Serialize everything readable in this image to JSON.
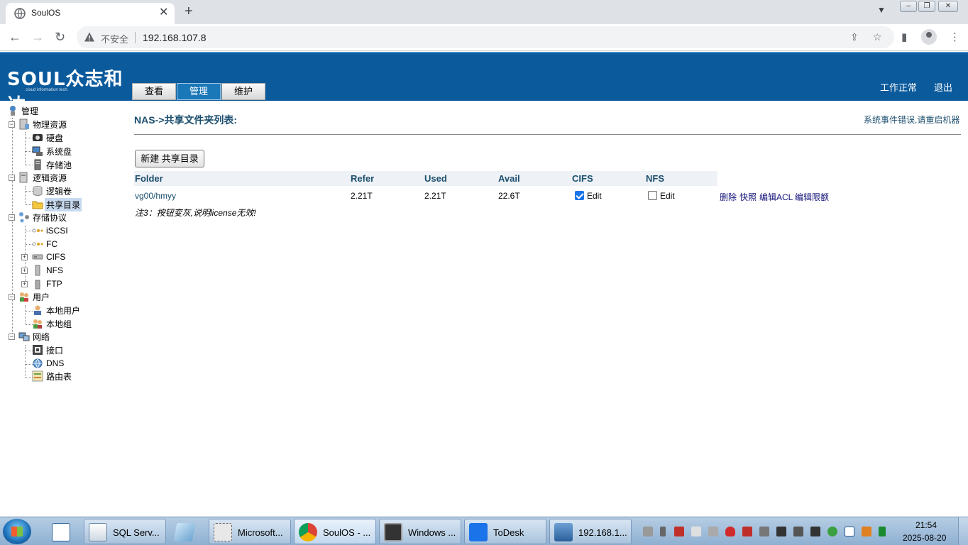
{
  "browser": {
    "tab_title": "SoulOS",
    "new_tab_symbol": "+",
    "close_symbol": "✕",
    "not_secure": "不安全",
    "url": "192.168.107.8"
  },
  "header": {
    "logo_text": "SOUL众志和达",
    "logo_subtitle": "cloud information tech.",
    "tabs": [
      {
        "label": "查看",
        "active": false
      },
      {
        "label": "管理",
        "active": true
      },
      {
        "label": "维护",
        "active": false
      }
    ],
    "status": "工作正常",
    "logout": "退出",
    "colors": {
      "header_bg": "#0b5a9c",
      "active_tab": "#1b78b8"
    }
  },
  "tree": {
    "root": "管理",
    "physical": "物理资源",
    "disk": "硬盘",
    "system_disk": "系统盘",
    "storage_pool": "存储池",
    "logical": "逻辑资源",
    "logical_volume": "逻辑卷",
    "shared_dir": "共享目录",
    "protocols": "存储协议",
    "iscsi": "iSCSI",
    "fc": "FC",
    "cifs": "CIFS",
    "nfs": "NFS",
    "ftp": "FTP",
    "users": "用户",
    "local_user": "本地用户",
    "local_group": "本地组",
    "network": "网络",
    "interface": "接口",
    "dns": "DNS",
    "routes": "路由表"
  },
  "main": {
    "title": "NAS->共享文件夹列表:",
    "sys_error": "系统事件错误,请重启机器",
    "new_button": "新建 共享目录",
    "columns": [
      "Folder",
      "Refer",
      "Used",
      "Avail",
      "CIFS",
      "NFS"
    ],
    "rows": [
      {
        "folder": "vg00/hmyy",
        "refer": "2.21T",
        "used": "2.21T",
        "avail": "22.6T",
        "cifs_checked": true,
        "cifs_edit": "Edit",
        "nfs_checked": false,
        "nfs_edit": "Edit",
        "actions": [
          "删除",
          "快照",
          "编辑ACL",
          "编辑限额"
        ]
      }
    ],
    "note": "注3：按钮变灰,说明license无效!"
  },
  "taskbar": {
    "items": [
      {
        "label": "SQL Serv..."
      },
      {
        "label": "Microsoft..."
      },
      {
        "label": "SoulOS - ..."
      },
      {
        "label": "Windows ..."
      },
      {
        "label": "ToDesk"
      },
      {
        "label": "192.168.1..."
      }
    ],
    "time": "21:54",
    "date": "2025-08-20"
  }
}
